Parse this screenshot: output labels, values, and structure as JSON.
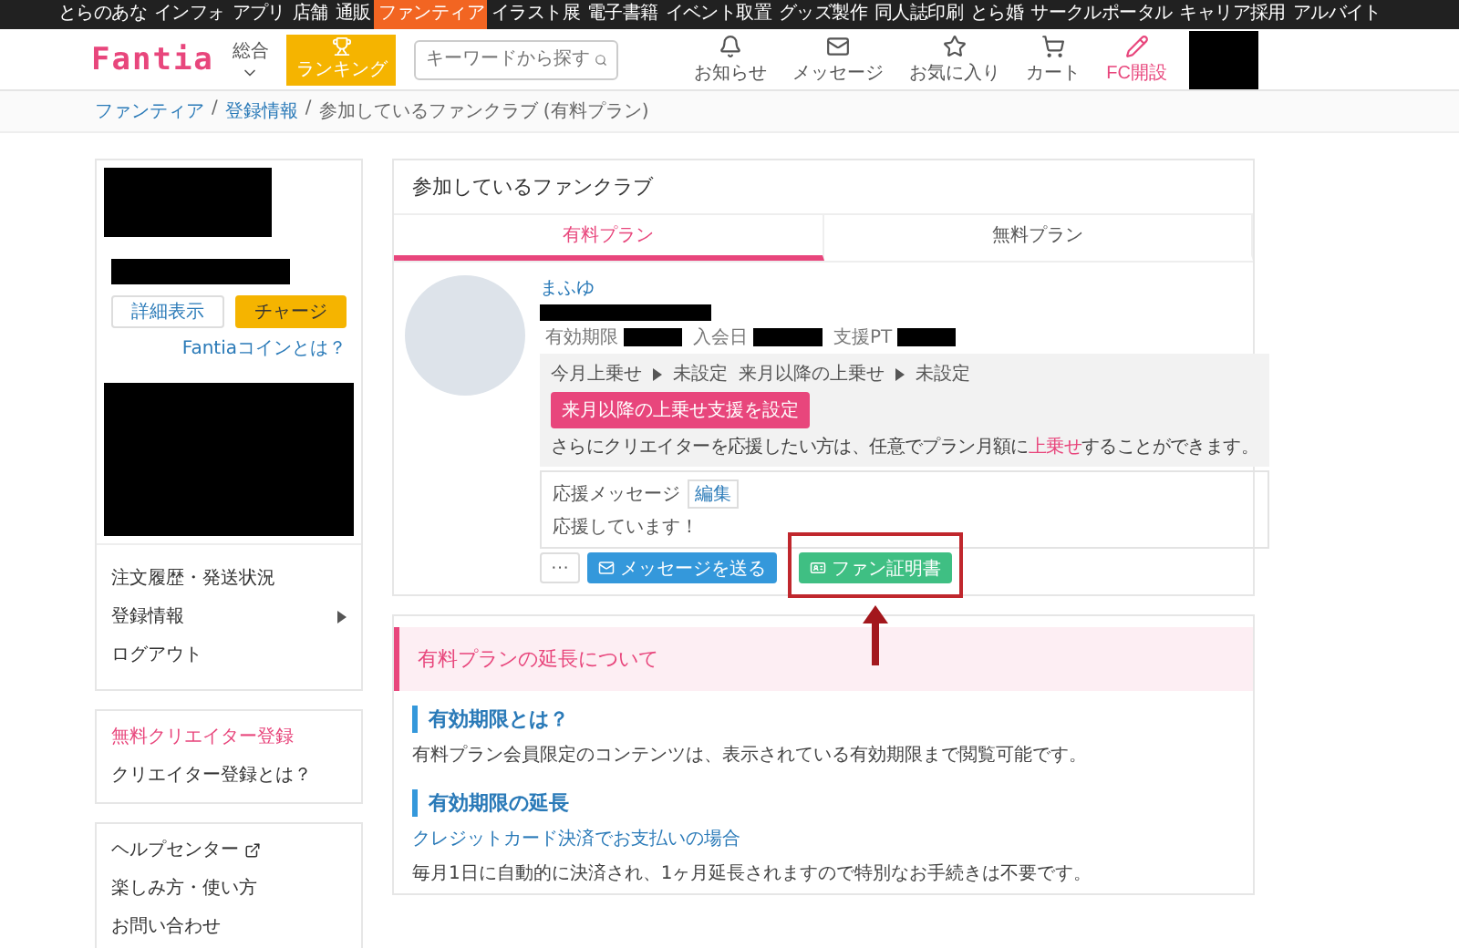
{
  "top_nav": [
    {
      "label": "とらのあな",
      "selected": false
    },
    {
      "label": "インフォ",
      "selected": false
    },
    {
      "label": "アプリ",
      "selected": false
    },
    {
      "label": "店舗",
      "selected": false
    },
    {
      "label": "通販",
      "selected": false
    },
    {
      "label": "ファンティア",
      "selected": true
    },
    {
      "label": "イラスト展",
      "selected": false
    },
    {
      "label": "電子書籍",
      "selected": false
    },
    {
      "label": "イベント取置",
      "selected": false
    },
    {
      "label": "グッズ製作",
      "selected": false
    },
    {
      "label": "同人誌印刷",
      "selected": false
    },
    {
      "label": "とら婚",
      "selected": false
    },
    {
      "label": "サークルポータル",
      "selected": false
    },
    {
      "label": "キャリア採用",
      "selected": false
    },
    {
      "label": "アルバイト",
      "selected": false
    }
  ],
  "header": {
    "logo": "Fantia",
    "category": "総合",
    "ranking": "ランキング",
    "search": {
      "placeholder": "キーワードから探す"
    },
    "icons": [
      {
        "kind": "bell",
        "label": "お知らせ"
      },
      {
        "kind": "mail",
        "label": "メッセージ"
      },
      {
        "kind": "star",
        "label": "お気に入り"
      },
      {
        "kind": "cart",
        "label": "カート"
      }
    ],
    "fc_button": "FC開設"
  },
  "breadcrumb": {
    "separator": "/",
    "items": [
      {
        "label": "ファンティア",
        "link": true
      },
      {
        "label": "登録情報",
        "link": true
      },
      {
        "label": "参加しているファンクラブ (有料プラン)",
        "link": false
      }
    ]
  },
  "sidebar": {
    "coin_buttons": [
      {
        "label": "詳細表示",
        "kind": "outline"
      },
      {
        "label": "チャージ",
        "kind": "primary"
      }
    ],
    "coin_link": "Fantiaコインとは？",
    "menu": [
      {
        "label": "注文履歴・発送状況",
        "submenu": false
      },
      {
        "label": "登録情報",
        "submenu": true
      },
      {
        "label": "ログアウト",
        "submenu": false
      }
    ],
    "creator": [
      {
        "label": "無料クリエイター登録",
        "highlight": true
      },
      {
        "label": "クリエイター登録とは？",
        "highlight": false
      }
    ],
    "help": [
      {
        "label": "ヘルプセンター",
        "external": true
      },
      {
        "label": "楽しみ方・使い方",
        "external": false
      },
      {
        "label": "お問い合わせ",
        "external": false
      }
    ]
  },
  "main": {
    "title": "参加しているファンクラブ",
    "tabs": [
      {
        "label": "有料プラン",
        "selected": true
      },
      {
        "label": "無料プラン",
        "selected": false
      }
    ],
    "club": {
      "name": "まふゆ",
      "meta": [
        "有効期限",
        "入会日",
        "支援PT"
      ],
      "topup": [
        {
          "label": "今月上乗せ",
          "value": "未設定"
        },
        {
          "label": "来月以降の上乗せ",
          "value": "未設定"
        }
      ],
      "topup_button": "来月以降の上乗せ支援を設定",
      "topup_note": "さらにクリエイターを応援したい方は、任意でプラン月額に**上乗せ**することができます。",
      "message": {
        "label": "応援メッセージ",
        "edit": "編集",
        "text": "応援しています！"
      },
      "actions": [
        {
          "kind": "more",
          "label": "···"
        },
        {
          "kind": "message",
          "label": "メッセージを送る"
        },
        {
          "kind": "certificate",
          "label": "ファン証明書"
        }
      ]
    }
  },
  "extension": {
    "title": "有料プランの延長について",
    "sections": [
      {
        "heading": "有効期限とは？",
        "text": "有料プラン会員限定のコンテンツは、表示されている有効期限まで閲覧可能です。"
      },
      {
        "heading": "有効期限の延長",
        "subheading": "クレジットカード決済でお支払いの場合",
        "text": "毎月1日に自動的に決済され、1ヶ月延長されますので特別なお手続きは不要です。"
      }
    ]
  }
}
